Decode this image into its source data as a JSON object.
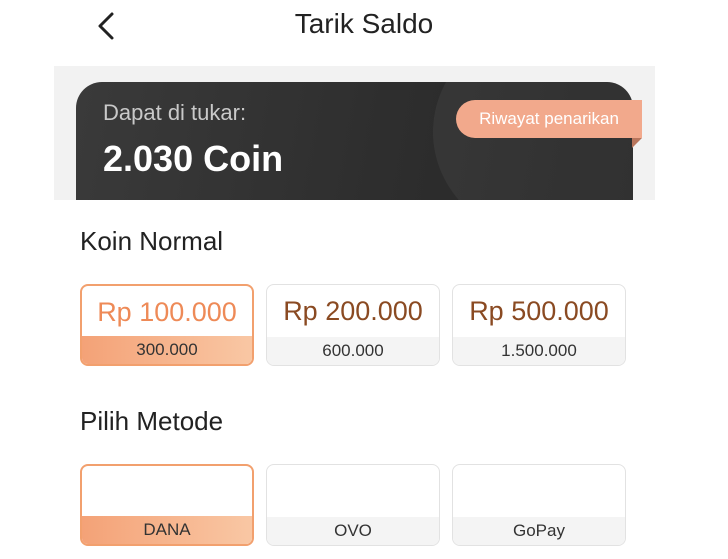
{
  "header": {
    "title": "Tarik Saldo"
  },
  "balance": {
    "label": "Dapat di tukar:",
    "amount": "2.030 Coin",
    "history_button": "Riwayat penarikan"
  },
  "normal": {
    "title": "Koin Normal",
    "options": [
      {
        "price": "Rp 100.000",
        "coins": "300.000",
        "selected": true
      },
      {
        "price": "Rp 200.000",
        "coins": "600.000",
        "selected": false
      },
      {
        "price": "Rp 500.000",
        "coins": "1.500.000",
        "selected": false
      }
    ]
  },
  "method": {
    "title": "Pilih Metode",
    "options": [
      {
        "name": "DANA",
        "selected": true
      },
      {
        "name": "OVO",
        "selected": false
      },
      {
        "name": "GoPay",
        "selected": false
      }
    ]
  },
  "colors": {
    "accent": "#ee8a57",
    "price_text": "#8a4a22",
    "card_bg": "#2e2e2e",
    "history_btn": "#f2a98c"
  },
  "icons": {
    "back": "chevron-left-icon"
  }
}
